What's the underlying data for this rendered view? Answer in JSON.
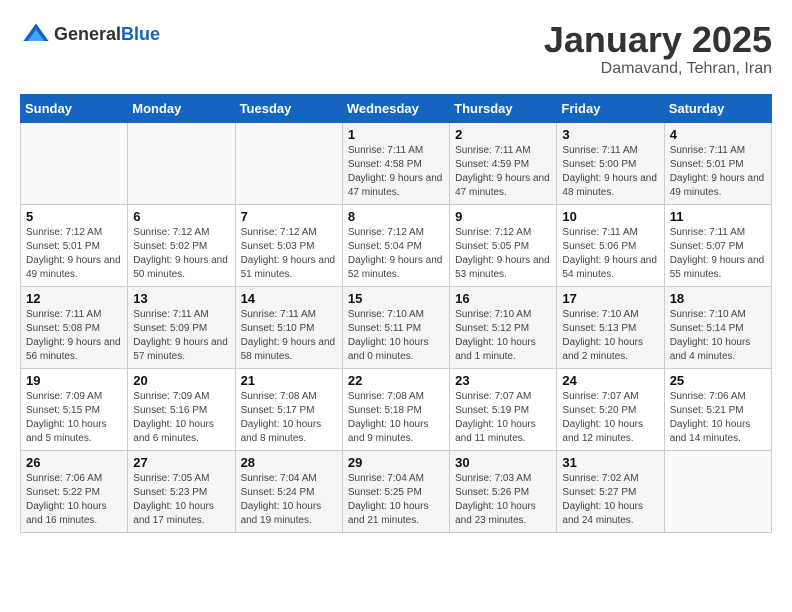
{
  "logo": {
    "text_general": "General",
    "text_blue": "Blue"
  },
  "header": {
    "title": "January 2025",
    "subtitle": "Damavand, Tehran, Iran"
  },
  "weekdays": [
    "Sunday",
    "Monday",
    "Tuesday",
    "Wednesday",
    "Thursday",
    "Friday",
    "Saturday"
  ],
  "weeks": [
    [
      {
        "day": "",
        "sunrise": "",
        "sunset": "",
        "daylight": ""
      },
      {
        "day": "",
        "sunrise": "",
        "sunset": "",
        "daylight": ""
      },
      {
        "day": "",
        "sunrise": "",
        "sunset": "",
        "daylight": ""
      },
      {
        "day": "1",
        "sunrise": "Sunrise: 7:11 AM",
        "sunset": "Sunset: 4:58 PM",
        "daylight": "Daylight: 9 hours and 47 minutes."
      },
      {
        "day": "2",
        "sunrise": "Sunrise: 7:11 AM",
        "sunset": "Sunset: 4:59 PM",
        "daylight": "Daylight: 9 hours and 47 minutes."
      },
      {
        "day": "3",
        "sunrise": "Sunrise: 7:11 AM",
        "sunset": "Sunset: 5:00 PM",
        "daylight": "Daylight: 9 hours and 48 minutes."
      },
      {
        "day": "4",
        "sunrise": "Sunrise: 7:11 AM",
        "sunset": "Sunset: 5:01 PM",
        "daylight": "Daylight: 9 hours and 49 minutes."
      }
    ],
    [
      {
        "day": "5",
        "sunrise": "Sunrise: 7:12 AM",
        "sunset": "Sunset: 5:01 PM",
        "daylight": "Daylight: 9 hours and 49 minutes."
      },
      {
        "day": "6",
        "sunrise": "Sunrise: 7:12 AM",
        "sunset": "Sunset: 5:02 PM",
        "daylight": "Daylight: 9 hours and 50 minutes."
      },
      {
        "day": "7",
        "sunrise": "Sunrise: 7:12 AM",
        "sunset": "Sunset: 5:03 PM",
        "daylight": "Daylight: 9 hours and 51 minutes."
      },
      {
        "day": "8",
        "sunrise": "Sunrise: 7:12 AM",
        "sunset": "Sunset: 5:04 PM",
        "daylight": "Daylight: 9 hours and 52 minutes."
      },
      {
        "day": "9",
        "sunrise": "Sunrise: 7:12 AM",
        "sunset": "Sunset: 5:05 PM",
        "daylight": "Daylight: 9 hours and 53 minutes."
      },
      {
        "day": "10",
        "sunrise": "Sunrise: 7:11 AM",
        "sunset": "Sunset: 5:06 PM",
        "daylight": "Daylight: 9 hours and 54 minutes."
      },
      {
        "day": "11",
        "sunrise": "Sunrise: 7:11 AM",
        "sunset": "Sunset: 5:07 PM",
        "daylight": "Daylight: 9 hours and 55 minutes."
      }
    ],
    [
      {
        "day": "12",
        "sunrise": "Sunrise: 7:11 AM",
        "sunset": "Sunset: 5:08 PM",
        "daylight": "Daylight: 9 hours and 56 minutes."
      },
      {
        "day": "13",
        "sunrise": "Sunrise: 7:11 AM",
        "sunset": "Sunset: 5:09 PM",
        "daylight": "Daylight: 9 hours and 57 minutes."
      },
      {
        "day": "14",
        "sunrise": "Sunrise: 7:11 AM",
        "sunset": "Sunset: 5:10 PM",
        "daylight": "Daylight: 9 hours and 58 minutes."
      },
      {
        "day": "15",
        "sunrise": "Sunrise: 7:10 AM",
        "sunset": "Sunset: 5:11 PM",
        "daylight": "Daylight: 10 hours and 0 minutes."
      },
      {
        "day": "16",
        "sunrise": "Sunrise: 7:10 AM",
        "sunset": "Sunset: 5:12 PM",
        "daylight": "Daylight: 10 hours and 1 minute."
      },
      {
        "day": "17",
        "sunrise": "Sunrise: 7:10 AM",
        "sunset": "Sunset: 5:13 PM",
        "daylight": "Daylight: 10 hours and 2 minutes."
      },
      {
        "day": "18",
        "sunrise": "Sunrise: 7:10 AM",
        "sunset": "Sunset: 5:14 PM",
        "daylight": "Daylight: 10 hours and 4 minutes."
      }
    ],
    [
      {
        "day": "19",
        "sunrise": "Sunrise: 7:09 AM",
        "sunset": "Sunset: 5:15 PM",
        "daylight": "Daylight: 10 hours and 5 minutes."
      },
      {
        "day": "20",
        "sunrise": "Sunrise: 7:09 AM",
        "sunset": "Sunset: 5:16 PM",
        "daylight": "Daylight: 10 hours and 6 minutes."
      },
      {
        "day": "21",
        "sunrise": "Sunrise: 7:08 AM",
        "sunset": "Sunset: 5:17 PM",
        "daylight": "Daylight: 10 hours and 8 minutes."
      },
      {
        "day": "22",
        "sunrise": "Sunrise: 7:08 AM",
        "sunset": "Sunset: 5:18 PM",
        "daylight": "Daylight: 10 hours and 9 minutes."
      },
      {
        "day": "23",
        "sunrise": "Sunrise: 7:07 AM",
        "sunset": "Sunset: 5:19 PM",
        "daylight": "Daylight: 10 hours and 11 minutes."
      },
      {
        "day": "24",
        "sunrise": "Sunrise: 7:07 AM",
        "sunset": "Sunset: 5:20 PM",
        "daylight": "Daylight: 10 hours and 12 minutes."
      },
      {
        "day": "25",
        "sunrise": "Sunrise: 7:06 AM",
        "sunset": "Sunset: 5:21 PM",
        "daylight": "Daylight: 10 hours and 14 minutes."
      }
    ],
    [
      {
        "day": "26",
        "sunrise": "Sunrise: 7:06 AM",
        "sunset": "Sunset: 5:22 PM",
        "daylight": "Daylight: 10 hours and 16 minutes."
      },
      {
        "day": "27",
        "sunrise": "Sunrise: 7:05 AM",
        "sunset": "Sunset: 5:23 PM",
        "daylight": "Daylight: 10 hours and 17 minutes."
      },
      {
        "day": "28",
        "sunrise": "Sunrise: 7:04 AM",
        "sunset": "Sunset: 5:24 PM",
        "daylight": "Daylight: 10 hours and 19 minutes."
      },
      {
        "day": "29",
        "sunrise": "Sunrise: 7:04 AM",
        "sunset": "Sunset: 5:25 PM",
        "daylight": "Daylight: 10 hours and 21 minutes."
      },
      {
        "day": "30",
        "sunrise": "Sunrise: 7:03 AM",
        "sunset": "Sunset: 5:26 PM",
        "daylight": "Daylight: 10 hours and 23 minutes."
      },
      {
        "day": "31",
        "sunrise": "Sunrise: 7:02 AM",
        "sunset": "Sunset: 5:27 PM",
        "daylight": "Daylight: 10 hours and 24 minutes."
      },
      {
        "day": "",
        "sunrise": "",
        "sunset": "",
        "daylight": ""
      }
    ]
  ]
}
